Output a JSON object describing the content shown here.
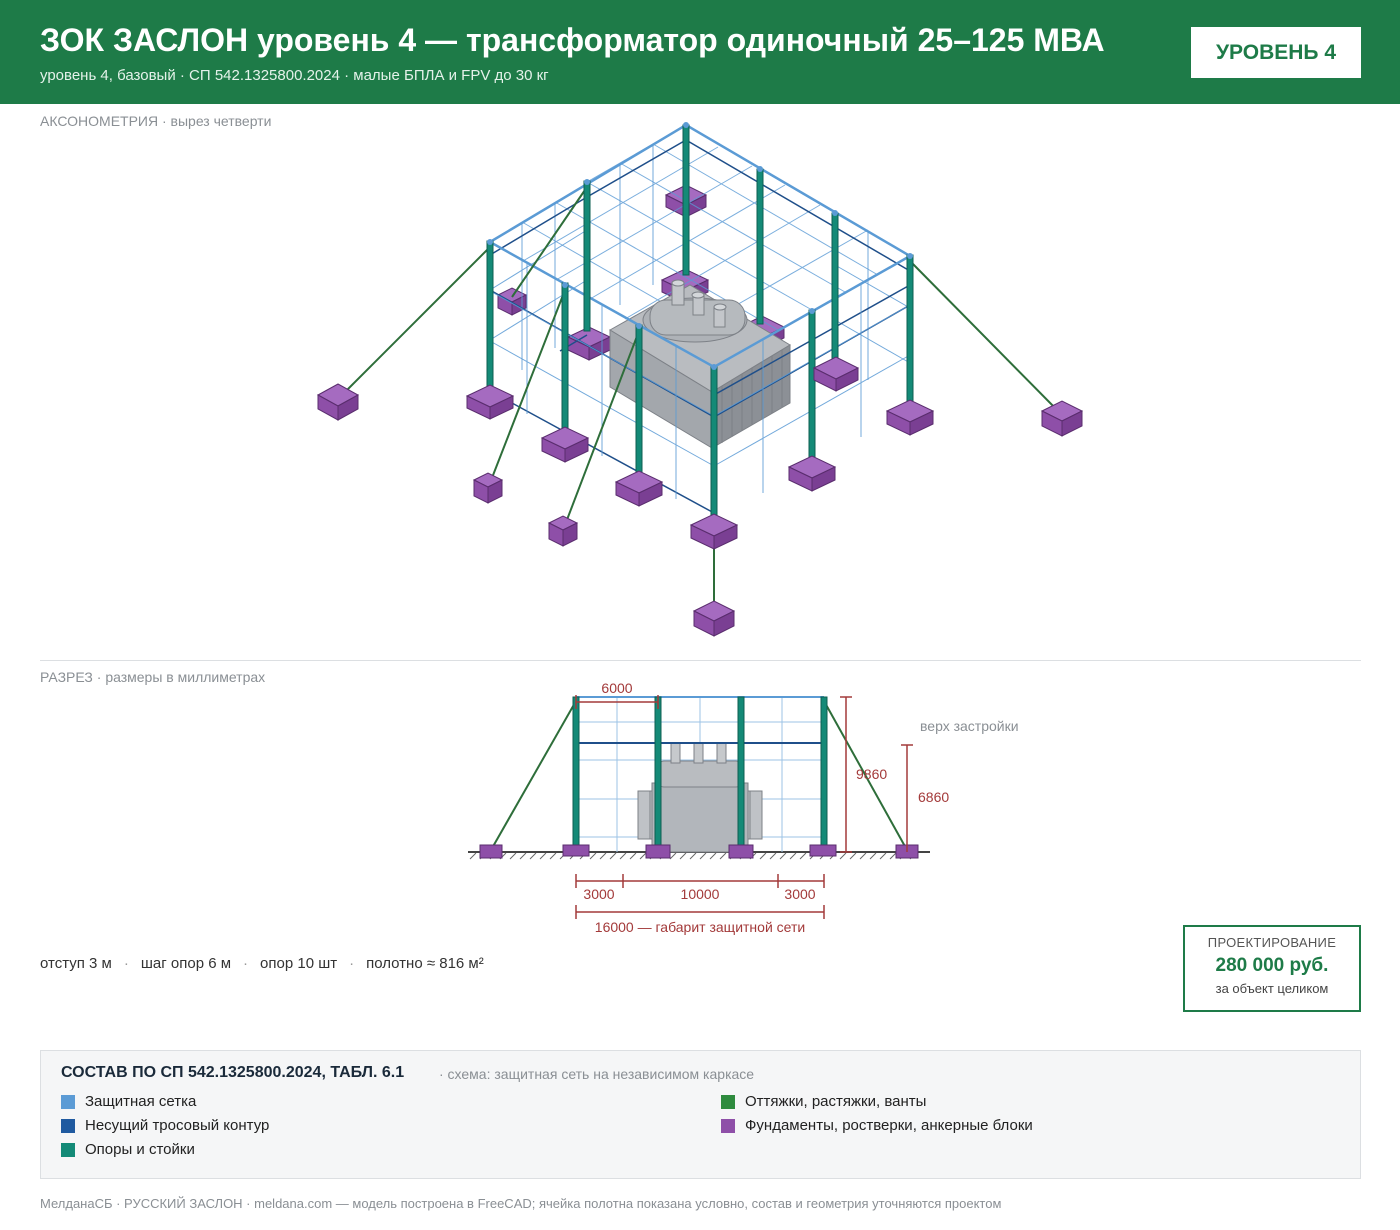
{
  "header": {
    "title": "ЗОК ЗАСЛОН уровень 4 — трансформатор одиночный 25–125 МВА",
    "subtitle": "уровень 4, базовый · СП 542.1325800.2024 · малые БПЛА и FPV до 30 кг",
    "level_badge": "УРОВЕНЬ 4"
  },
  "axon": {
    "label": "АКСОНОМЕТРИЯ",
    "note": " · вырез четверти"
  },
  "section": {
    "label": "РАЗРЕЗ",
    "note": " · размеры в миллиметрах",
    "dims": {
      "top_span": "6000",
      "height_total": "9860",
      "height_build": "6860",
      "build_top_label": "верх застройки",
      "offset_left": "3000",
      "middle": "10000",
      "offset_right": "3000",
      "overall": "16000 — габарит защитной сети"
    }
  },
  "stats": {
    "offset": "отступ 3 м",
    "pitch": "шаг опор 6 м",
    "supports": "опор 10 шт",
    "area": "полотно ≈ 816 м²"
  },
  "price": {
    "caption": "ПРОЕКТИРОВАНИЕ",
    "value": "280 000 руб.",
    "note": "за объект целиком"
  },
  "legend": {
    "title": "СОСТАВ ПО СП 542.1325800.2024, ТАБЛ. 6.1",
    "note": "· схема: защитная сеть на независимом каркасе",
    "items": [
      {
        "label": "Защитная сетка",
        "color": "#5b9bd5"
      },
      {
        "label": "Несущий тросовый контур",
        "color": "#1f5aa0"
      },
      {
        "label": "Опоры и стойки",
        "color": "#148a77"
      },
      {
        "label": "Оттяжки, растяжки, ванты",
        "color": "#2e8b3e"
      },
      {
        "label": "Фундаменты, ростверки, анкерные блоки",
        "color": "#8e4fa8"
      }
    ]
  },
  "footer": {
    "text": "МелданаСБ · РУССКИЙ ЗАСЛОН · meldana.com — модель построена в FreeCAD; ячейка полотна показана условно, состав и геометрия уточняются проектом"
  }
}
